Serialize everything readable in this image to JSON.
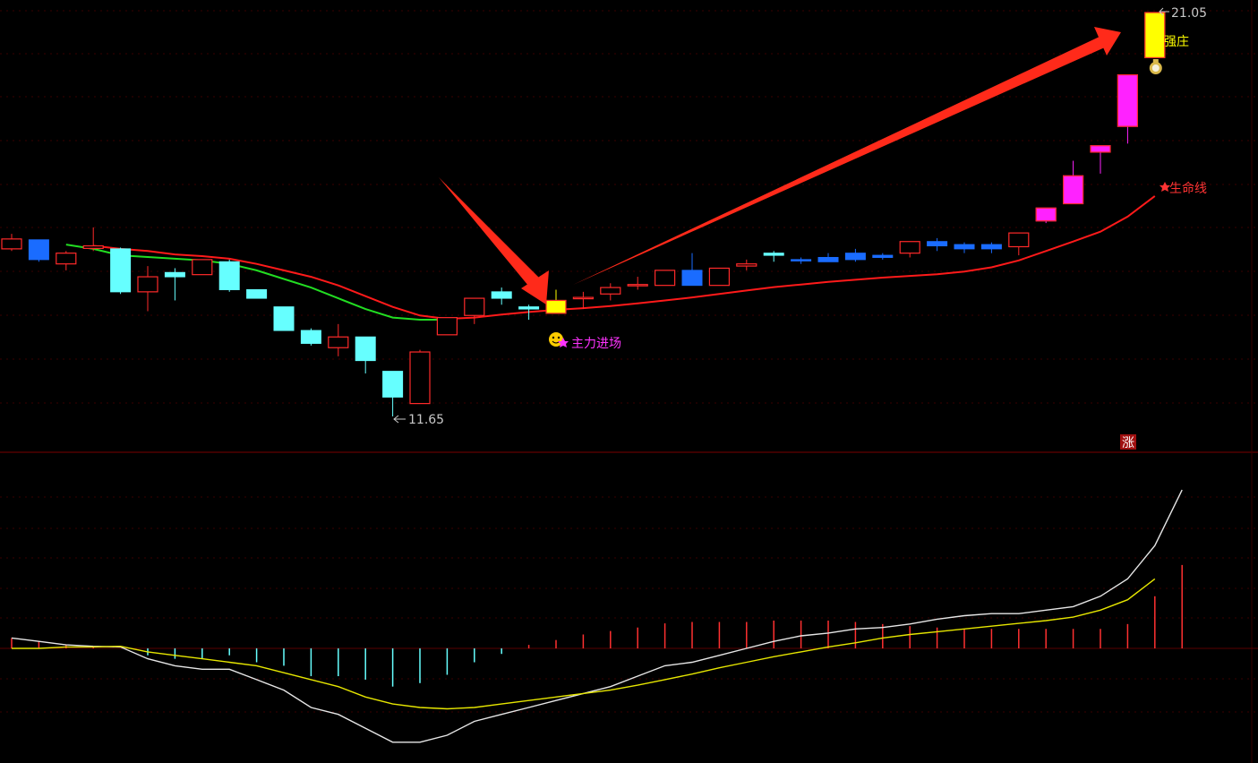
{
  "colors": {
    "background": "#000000",
    "up": "#ff2a2a",
    "down_cyan": "#66ffff",
    "down_blue": "#1a6cff",
    "special_yellow": "#ffff00",
    "special_magenta": "#ff22ff",
    "ma_green": "#22dd22",
    "ma_red": "#ff1a1a",
    "grid": "#3a0000",
    "dif_line": "#e6e6e6",
    "dea_line": "#e6e600",
    "arrow": "#ff2a1a",
    "label_magenta": "#ff33ff",
    "label_yellow": "#ffff00",
    "label_red": "#ff3333",
    "label_gray": "#c8c8c8"
  },
  "annotations": {
    "max_label": "21.05",
    "min_label": "11.65",
    "strong_label": "强庄",
    "entry_label": "主力进场",
    "lifeline_label": "生命线",
    "limit_up_badge": "涨"
  },
  "chart_data": [
    {
      "type": "candlestick",
      "title": "",
      "ylim": [
        10.5,
        21.5
      ],
      "high_label": 21.05,
      "low_label": 11.65,
      "candles": [
        {
          "o": 15.55,
          "c": 15.78,
          "h": 15.9,
          "l": 15.5,
          "color": "up"
        },
        {
          "o": 15.76,
          "c": 15.3,
          "h": 15.76,
          "l": 15.25,
          "color": "down_blue"
        },
        {
          "o": 15.2,
          "c": 15.45,
          "h": 15.5,
          "l": 15.05,
          "color": "up"
        },
        {
          "o": 15.56,
          "c": 15.62,
          "h": 16.05,
          "l": 15.5,
          "color": "up"
        },
        {
          "o": 15.55,
          "c": 14.55,
          "h": 15.58,
          "l": 14.5,
          "color": "down_cyan"
        },
        {
          "o": 14.55,
          "c": 14.9,
          "h": 15.15,
          "l": 14.1,
          "color": "up"
        },
        {
          "o": 15.0,
          "c": 14.9,
          "h": 15.1,
          "l": 14.35,
          "color": "down_cyan"
        },
        {
          "o": 14.95,
          "c": 15.3,
          "h": 15.3,
          "l": 14.95,
          "color": "up"
        },
        {
          "o": 15.25,
          "c": 14.6,
          "h": 15.3,
          "l": 14.55,
          "color": "down_cyan"
        },
        {
          "o": 14.6,
          "c": 14.4,
          "h": 14.6,
          "l": 14.4,
          "color": "down_cyan"
        },
        {
          "o": 14.2,
          "c": 13.65,
          "h": 14.2,
          "l": 13.65,
          "color": "down_cyan"
        },
        {
          "o": 13.65,
          "c": 13.35,
          "h": 13.7,
          "l": 13.3,
          "color": "down_cyan"
        },
        {
          "o": 13.25,
          "c": 13.5,
          "h": 13.8,
          "l": 13.05,
          "color": "up"
        },
        {
          "o": 13.5,
          "c": 12.95,
          "h": 13.5,
          "l": 12.65,
          "color": "down_cyan"
        },
        {
          "o": 12.7,
          "c": 12.1,
          "h": 12.7,
          "l": 11.65,
          "color": "down_cyan"
        },
        {
          "o": 11.95,
          "c": 13.15,
          "h": 13.2,
          "l": 11.95,
          "color": "up"
        },
        {
          "o": 13.55,
          "c": 13.95,
          "h": 13.95,
          "l": 13.55,
          "color": "up"
        },
        {
          "o": 14.4,
          "c": 14.0,
          "h": 14.4,
          "l": 13.8,
          "color": "up"
        },
        {
          "o": 14.55,
          "c": 14.4,
          "h": 14.65,
          "l": 14.25,
          "color": "down_cyan"
        },
        {
          "o": 14.2,
          "c": 14.15,
          "h": 14.25,
          "l": 13.9,
          "color": "down_cyan"
        },
        {
          "o": 14.05,
          "c": 14.35,
          "h": 14.6,
          "l": 14.05,
          "color": "special_yellow"
        },
        {
          "o": 14.4,
          "c": 14.42,
          "h": 14.55,
          "l": 14.15,
          "color": "up"
        },
        {
          "o": 14.5,
          "c": 14.65,
          "h": 14.75,
          "l": 14.35,
          "color": "up"
        },
        {
          "o": 14.7,
          "c": 14.72,
          "h": 14.9,
          "l": 14.6,
          "color": "up"
        },
        {
          "o": 14.7,
          "c": 15.05,
          "h": 15.05,
          "l": 14.7,
          "color": "up"
        },
        {
          "o": 15.05,
          "c": 14.7,
          "h": 15.45,
          "l": 14.7,
          "color": "down_blue"
        },
        {
          "o": 14.7,
          "c": 15.1,
          "h": 15.1,
          "l": 14.7,
          "color": "up"
        },
        {
          "o": 15.15,
          "c": 15.2,
          "h": 15.3,
          "l": 15.05,
          "color": "up"
        },
        {
          "o": 15.45,
          "c": 15.4,
          "h": 15.5,
          "l": 15.25,
          "color": "down_cyan"
        },
        {
          "o": 15.3,
          "c": 15.28,
          "h": 15.35,
          "l": 15.2,
          "color": "down_blue"
        },
        {
          "o": 15.35,
          "c": 15.25,
          "h": 15.45,
          "l": 15.25,
          "color": "down_blue"
        },
        {
          "o": 15.45,
          "c": 15.3,
          "h": 15.55,
          "l": 15.25,
          "color": "down_blue"
        },
        {
          "o": 15.4,
          "c": 15.35,
          "h": 15.45,
          "l": 15.3,
          "color": "down_blue"
        },
        {
          "o": 15.45,
          "c": 15.72,
          "h": 15.72,
          "l": 15.35,
          "color": "up"
        },
        {
          "o": 15.72,
          "c": 15.62,
          "h": 15.8,
          "l": 15.5,
          "color": "down_blue"
        },
        {
          "o": 15.65,
          "c": 15.55,
          "h": 15.7,
          "l": 15.45,
          "color": "down_blue"
        },
        {
          "o": 15.65,
          "c": 15.55,
          "h": 15.7,
          "l": 15.45,
          "color": "down_blue"
        },
        {
          "o": 15.6,
          "c": 15.92,
          "h": 15.92,
          "l": 15.4,
          "color": "up"
        },
        {
          "o": 16.2,
          "c": 16.5,
          "h": 16.5,
          "l": 16.15,
          "color": "special_magenta"
        },
        {
          "o": 16.6,
          "c": 17.25,
          "h": 17.6,
          "l": 16.6,
          "color": "special_magenta"
        },
        {
          "o": 17.8,
          "c": 17.95,
          "h": 17.95,
          "l": 17.3,
          "color": "special_magenta"
        },
        {
          "o": 18.4,
          "c": 19.6,
          "h": 19.6,
          "l": 18.0,
          "color": "special_magenta"
        },
        {
          "o": 20.0,
          "c": 21.05,
          "h": 21.05,
          "l": 20.0,
          "color": "special_yellow"
        }
      ],
      "ma": [
        {
          "name": "",
          "segment": "green",
          "x": [
            2,
            3,
            4,
            5,
            6,
            7,
            8,
            9,
            10,
            11,
            12,
            13,
            14,
            15,
            16
          ],
          "y": [
            15.65,
            15.55,
            15.4,
            15.36,
            15.32,
            15.28,
            15.2,
            15.05,
            14.85,
            14.65,
            14.4,
            14.15,
            13.95,
            13.9,
            13.9
          ]
        },
        {
          "name": "",
          "segment": "red",
          "x": [
            3,
            4,
            5,
            6,
            7,
            8,
            9,
            10,
            11,
            12,
            13,
            14,
            15,
            16,
            17,
            18,
            19,
            20,
            21,
            22,
            23,
            24,
            25,
            26,
            27,
            28,
            29,
            30,
            31,
            32,
            33,
            34,
            35,
            36,
            37,
            38,
            39,
            40,
            41,
            42
          ],
          "y": [
            15.62,
            15.55,
            15.5,
            15.42,
            15.38,
            15.32,
            15.2,
            15.05,
            14.9,
            14.7,
            14.45,
            14.2,
            14.0,
            13.92,
            13.95,
            14.02,
            14.08,
            14.13,
            14.17,
            14.22,
            14.28,
            14.35,
            14.42,
            14.5,
            14.58,
            14.66,
            14.72,
            14.78,
            14.83,
            14.88,
            14.92,
            14.96,
            15.02,
            15.12,
            15.28,
            15.5,
            15.72,
            15.95,
            16.3,
            16.78,
            17.35
          ]
        }
      ]
    },
    {
      "type": "macd",
      "ylim": [
        -1.45,
        2.5
      ],
      "dif": [
        0.15,
        0.1,
        0.05,
        0.03,
        0.02,
        -0.15,
        -0.25,
        -0.3,
        -0.3,
        -0.45,
        -0.6,
        -0.85,
        -0.95,
        -1.15,
        -1.35,
        -1.35,
        -1.25,
        -1.05,
        -0.95,
        -0.85,
        -0.75,
        -0.65,
        -0.55,
        -0.4,
        -0.25,
        -0.2,
        -0.1,
        0.0,
        0.1,
        0.18,
        0.22,
        0.28,
        0.3,
        0.35,
        0.42,
        0.47,
        0.5,
        0.5,
        0.55,
        0.6,
        0.75,
        1.0,
        1.48,
        2.28
      ],
      "dea": [
        0.0,
        0.0,
        0.02,
        0.02,
        0.03,
        -0.05,
        -0.1,
        -0.15,
        -0.2,
        -0.25,
        -0.35,
        -0.45,
        -0.55,
        -0.7,
        -0.8,
        -0.85,
        -0.87,
        -0.85,
        -0.8,
        -0.75,
        -0.7,
        -0.65,
        -0.6,
        -0.53,
        -0.45,
        -0.37,
        -0.28,
        -0.2,
        -0.12,
        -0.05,
        0.02,
        0.08,
        0.15,
        0.2,
        0.24,
        0.28,
        0.32,
        0.36,
        0.4,
        0.45,
        0.55,
        0.7,
        1.0
      ],
      "hist": [
        0.15,
        0.1,
        0.05,
        0.03,
        0.0,
        -0.1,
        -0.15,
        -0.15,
        -0.1,
        -0.2,
        -0.25,
        -0.4,
        -0.4,
        -0.45,
        -0.55,
        -0.5,
        -0.38,
        -0.2,
        -0.08,
        0.05,
        0.12,
        0.2,
        0.25,
        0.3,
        0.36,
        0.38,
        0.38,
        0.38,
        0.4,
        0.4,
        0.4,
        0.38,
        0.35,
        0.32,
        0.3,
        0.28,
        0.28,
        0.28,
        0.28,
        0.28,
        0.28,
        0.35,
        0.75,
        1.2
      ]
    }
  ]
}
